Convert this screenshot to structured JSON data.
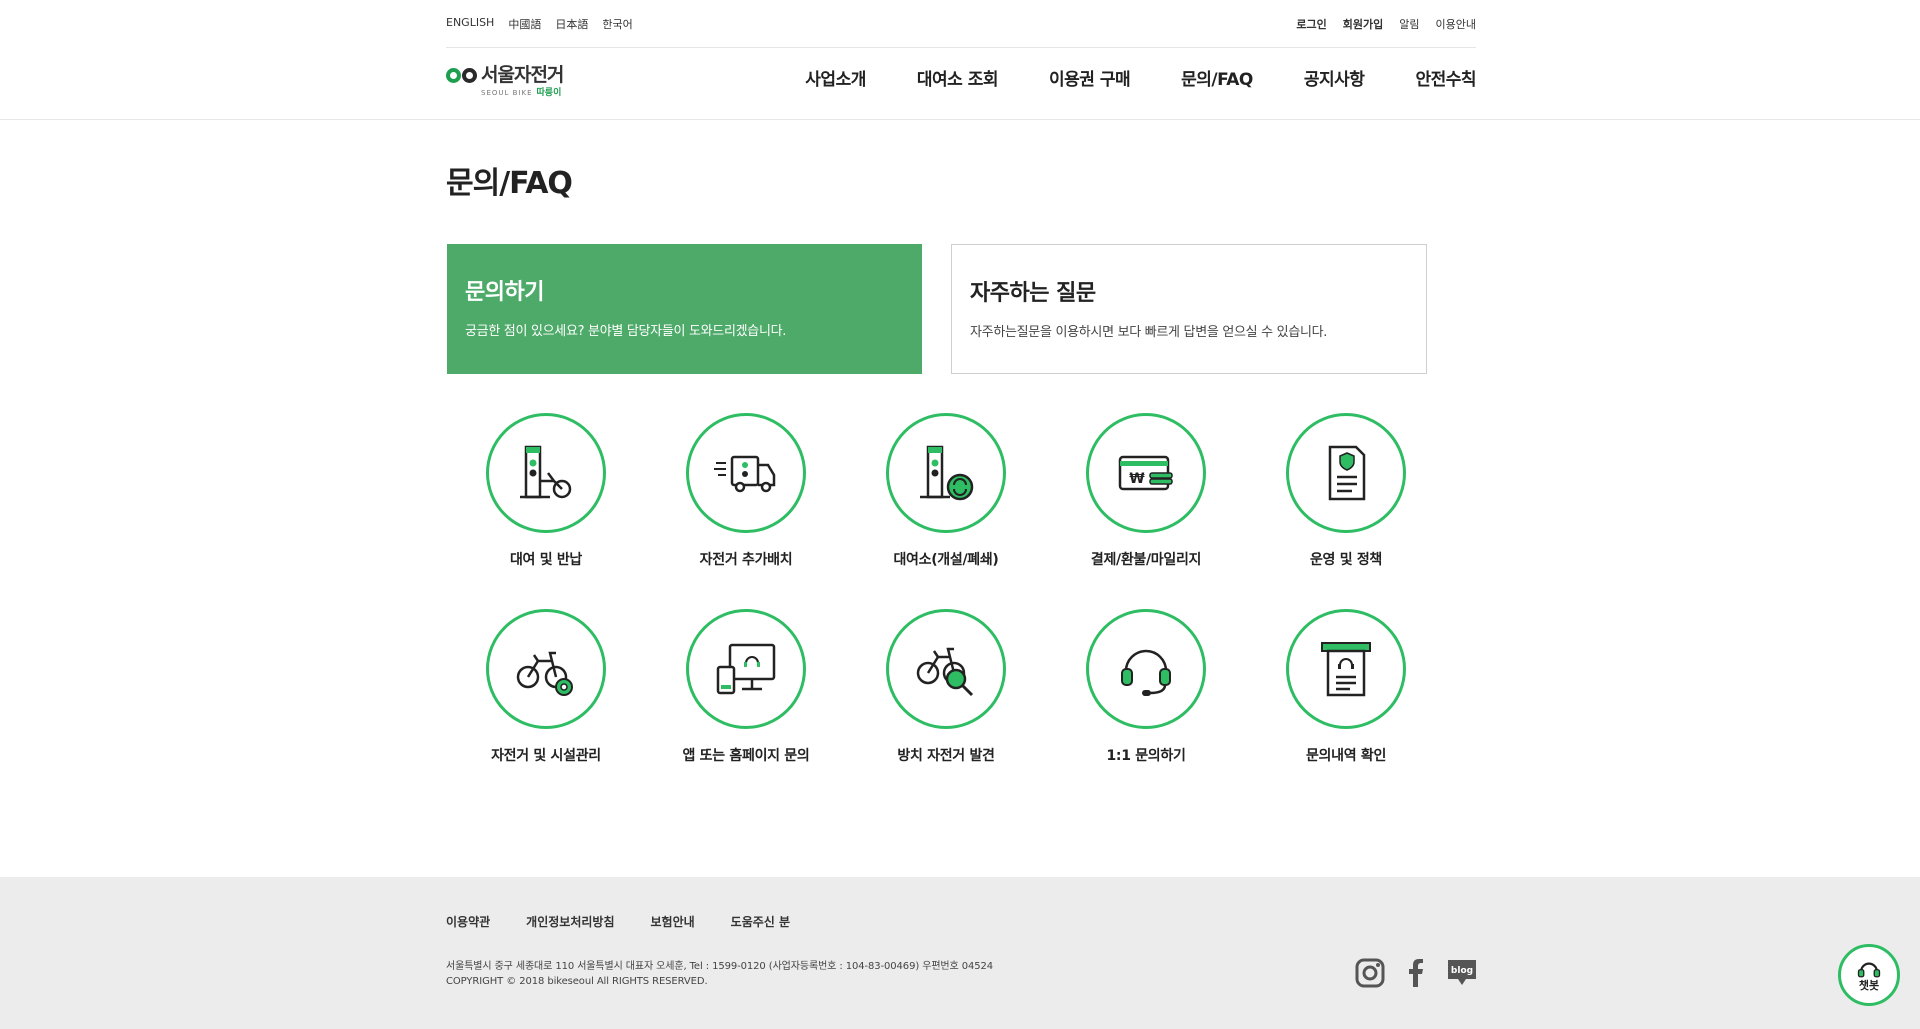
{
  "languages": [
    "ENGLISH",
    "中國語",
    "日本語",
    "한국어"
  ],
  "utility_links": [
    "로그인",
    "회원가입",
    "알림",
    "이용안내"
  ],
  "logo": {
    "main": "서울자전거",
    "sub": "SEOUL BIKE",
    "sub_brand": "따릉이"
  },
  "nav": [
    "사업소개",
    "대여소 조회",
    "이용권 구매",
    "문의/FAQ",
    "공지사항",
    "안전수칙"
  ],
  "page_title": "문의/FAQ",
  "inquiry_box": {
    "title": "문의하기",
    "desc": "궁금한 점이 있으세요? 분야별 담당자들이 도와드리겠습니다."
  },
  "faq_box": {
    "title": "자주하는 질문",
    "desc": "자주하는질문을 이용하시면 보다 빠르게 답변을 얻으실 수 있습니다."
  },
  "categories": [
    {
      "label": "대여 및 반납",
      "icon": "bike-dock-icon"
    },
    {
      "label": "자전거 추가배치",
      "icon": "delivery-truck-icon"
    },
    {
      "label": "대여소(개설/폐쇄)",
      "icon": "station-refresh-icon"
    },
    {
      "label": "결제/환불/마일리지",
      "icon": "payment-won-icon"
    },
    {
      "label": "운영 및 정책",
      "icon": "policy-document-icon"
    },
    {
      "label": "자전거 및 시설관리",
      "icon": "bike-gear-icon"
    },
    {
      "label": "앱 또는 홈페이지 문의",
      "icon": "app-web-support-icon"
    },
    {
      "label": "방치 자전거 발견",
      "icon": "bike-search-icon"
    },
    {
      "label": "1:1 문의하기",
      "icon": "headset-icon"
    },
    {
      "label": "문의내역 확인",
      "icon": "receipt-history-icon"
    }
  ],
  "footer": {
    "links": [
      "이용약관",
      "개인정보처리방침",
      "보험안내",
      "도움주신 분"
    ],
    "address": "서울특별시 중구 세종대로 110 서울특별시 대표자 오세훈, Tel : 1599-0120 (사업자등록번호 : 104-83-00469) 우편번호 04524",
    "copyright": "COPYRIGHT © 2018 bikeseoul All RIGHTS RESERVED.",
    "social": [
      "instagram-icon",
      "facebook-icon",
      "blog-icon"
    ],
    "blog_label": "blog"
  },
  "chatbot_label": "챗봇",
  "colors": {
    "brand_green": "#2ebd63",
    "inquiry_bg": "#4daa69",
    "footer_bg": "#ececec"
  }
}
